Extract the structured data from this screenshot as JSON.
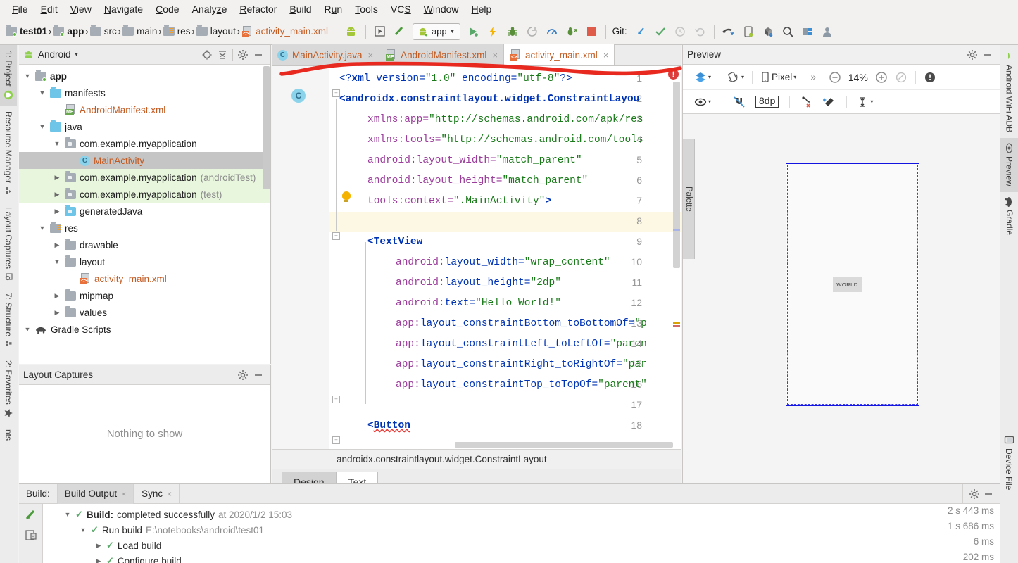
{
  "menu": {
    "items": [
      "File",
      "Edit",
      "View",
      "Navigate",
      "Code",
      "Analyze",
      "Refactor",
      "Build",
      "Run",
      "Tools",
      "VCS",
      "Window",
      "Help"
    ]
  },
  "toolbar": {
    "breadcrumb": [
      {
        "label": "test01",
        "style": "bold",
        "icon": "module-icon"
      },
      {
        "label": "app",
        "style": "bold",
        "icon": "module-icon"
      },
      {
        "label": "src",
        "style": "plain",
        "icon": "folder-icon"
      },
      {
        "label": "main",
        "style": "plain",
        "icon": "folder-icon"
      },
      {
        "label": "res",
        "style": "plain",
        "icon": "res-folder-icon"
      },
      {
        "label": "layout",
        "style": "plain",
        "icon": "folder-icon"
      },
      {
        "label": "activity_main.xml",
        "style": "orange",
        "icon": "xml-file-icon"
      }
    ],
    "separator": "›",
    "run_config": "app",
    "git_label": "Git:",
    "buttons": [
      "avd-manager-icon",
      "run-device-icon",
      "sdk-manager-icon",
      "run-icon",
      "apply-changes-icon",
      "debug-icon",
      "attach-debugger-icon",
      "profiler-icon",
      "run-coverage-icon",
      "stop-icon",
      "git-update-icon",
      "git-commit-icon",
      "git-history-icon",
      "git-revert-icon",
      "sync-gradle-icon",
      "avd-icon",
      "sdk-download-icon",
      "search-everywhere-icon",
      "project-structure-icon",
      "settings-avatar-icon"
    ]
  },
  "left_strip": {
    "tabs": [
      {
        "label": "1: Project",
        "icon": "android-icon",
        "active": true
      },
      {
        "label": "Resource Manager",
        "icon": "resource-icon",
        "active": false
      },
      {
        "label": "Layout Captures",
        "icon": "capture-icon",
        "active": false
      },
      {
        "label": "7: Structure",
        "icon": "structure-icon",
        "active": false
      },
      {
        "label": "2: Favorites",
        "icon": "star-icon",
        "active": false
      },
      {
        "label": "nts",
        "icon": "docs-icon",
        "active": false
      }
    ]
  },
  "right_strip": {
    "tabs": [
      {
        "label": "Android WiFi ADB",
        "icon": "wifi-adb-icon",
        "active": false
      },
      {
        "label": "Preview",
        "icon": "eye-icon",
        "active": true
      },
      {
        "label": "Gradle",
        "icon": "gradle-elephant-icon",
        "active": false
      },
      {
        "label": "Device File",
        "icon": "device-icon",
        "active": false
      }
    ]
  },
  "project_panel": {
    "title": "Android",
    "title_caret": "▾",
    "header_icons": [
      "locate-icon",
      "collapse-all-icon",
      "gear-icon",
      "minimize-icon"
    ],
    "tree": [
      {
        "indent": 0,
        "arrow": "▼",
        "icon": "module-icon",
        "label": "app",
        "style": "bold"
      },
      {
        "indent": 1,
        "arrow": "▼",
        "icon": "folder-blue-icon",
        "label": "manifests",
        "style": "plain"
      },
      {
        "indent": 2,
        "arrow": "",
        "icon": "manifest-file-icon",
        "label": "AndroidManifest.xml",
        "style": "orange"
      },
      {
        "indent": 1,
        "arrow": "▼",
        "icon": "folder-blue-icon",
        "label": "java",
        "style": "plain"
      },
      {
        "indent": 2,
        "arrow": "▼",
        "icon": "package-icon",
        "label": "com.example.myapplication",
        "style": "plain"
      },
      {
        "indent": 3,
        "arrow": "",
        "icon": "class-icon",
        "label": "MainActivity",
        "style": "orange",
        "selected": true
      },
      {
        "indent": 2,
        "arrow": "▶",
        "icon": "package-icon",
        "label": "com.example.myapplication",
        "suffix": "(androidTest)",
        "style": "plain",
        "green": true
      },
      {
        "indent": 2,
        "arrow": "▶",
        "icon": "package-icon",
        "label": "com.example.myapplication",
        "suffix": "(test)",
        "style": "plain",
        "green": true
      },
      {
        "indent": 2,
        "arrow": "▶",
        "icon": "generated-folder-icon",
        "label": "generatedJava",
        "style": "plain"
      },
      {
        "indent": 1,
        "arrow": "▼",
        "icon": "res-folder-icon",
        "label": "res",
        "style": "plain"
      },
      {
        "indent": 2,
        "arrow": "▶",
        "icon": "folder-icon",
        "label": "drawable",
        "style": "plain"
      },
      {
        "indent": 2,
        "arrow": "▼",
        "icon": "folder-icon",
        "label": "layout",
        "style": "plain"
      },
      {
        "indent": 3,
        "arrow": "",
        "icon": "xml-file-icon",
        "label": "activity_main.xml",
        "style": "orange"
      },
      {
        "indent": 2,
        "arrow": "▶",
        "icon": "folder-icon",
        "label": "mipmap",
        "style": "plain"
      },
      {
        "indent": 2,
        "arrow": "▶",
        "icon": "folder-icon",
        "label": "values",
        "style": "plain"
      },
      {
        "indent": 0,
        "arrow": "▼",
        "icon": "gradle-elephant-icon",
        "label": "Gradle Scripts",
        "style": "plain"
      }
    ]
  },
  "layout_captures_panel": {
    "title": "Layout Captures",
    "empty_text": "Nothing to show",
    "header_icons": [
      "gear-icon",
      "minimize-icon"
    ]
  },
  "editor": {
    "tabs": [
      {
        "label": "MainActivity.java",
        "icon": "class-icon",
        "active": false,
        "close": "×"
      },
      {
        "label": "AndroidManifest.xml",
        "icon": "manifest-file-icon",
        "active": false,
        "close": "×"
      },
      {
        "label": "activity_main.xml",
        "icon": "xml-file-icon",
        "active": true,
        "close": "×"
      }
    ],
    "error_badge": "!",
    "breadcrumb": "androidx.constraintlayout.widget.ConstraintLayout",
    "bottom_tabs": [
      {
        "label": "Design",
        "active": false
      },
      {
        "label": "Text",
        "active": true
      }
    ],
    "current_line": 8,
    "lines": [
      {
        "n": 1,
        "segments": [
          {
            "t": "<?",
            "c": "tok-pi"
          },
          {
            "t": "xml",
            "c": "tok-tag"
          },
          {
            "t": " version=",
            "c": "tok-pi"
          },
          {
            "t": "\"1.0\"",
            "c": "tok-str"
          },
          {
            "t": " encoding=",
            "c": "tok-pi"
          },
          {
            "t": "\"utf-8\"",
            "c": "tok-str"
          },
          {
            "t": "?>",
            "c": "tok-pi"
          }
        ],
        "indent": 0
      },
      {
        "n": 2,
        "segments": [
          {
            "t": "<androidx.constraintlayout.widget.ConstraintLayou",
            "c": "tok-tag"
          }
        ],
        "indent": 0
      },
      {
        "n": 3,
        "segments": [
          {
            "t": "xmlns:app=",
            "c": "tok-attr"
          },
          {
            "t": "\"http://schemas.android.com/apk/res",
            "c": "tok-str"
          }
        ],
        "indent": 1
      },
      {
        "n": 4,
        "segments": [
          {
            "t": "xmlns:tools=",
            "c": "tok-attr"
          },
          {
            "t": "\"http://schemas.android.com/tools",
            "c": "tok-str"
          }
        ],
        "indent": 1
      },
      {
        "n": 5,
        "segments": [
          {
            "t": "android:layout_width=",
            "c": "tok-attr"
          },
          {
            "t": "\"match_parent\"",
            "c": "tok-str"
          }
        ],
        "indent": 1
      },
      {
        "n": 6,
        "segments": [
          {
            "t": "android:layout_height=",
            "c": "tok-attr"
          },
          {
            "t": "\"match_parent\"",
            "c": "tok-str"
          }
        ],
        "indent": 1
      },
      {
        "n": 7,
        "segments": [
          {
            "t": "tools:context=",
            "c": "tok-attr"
          },
          {
            "t": "\".MainActivity\"",
            "c": "tok-str"
          },
          {
            "t": ">",
            "c": "tok-tag"
          }
        ],
        "indent": 1
      },
      {
        "n": 8,
        "segments": [],
        "indent": 0
      },
      {
        "n": 9,
        "segments": [
          {
            "t": "<TextView",
            "c": "tok-tag"
          }
        ],
        "indent": 1
      },
      {
        "n": 10,
        "segments": [
          {
            "t": "android:",
            "c": "tok-attr"
          },
          {
            "t": "layout_width=",
            "c": "tok-attr2"
          },
          {
            "t": "\"wrap_content\"",
            "c": "tok-str"
          }
        ],
        "indent": 2
      },
      {
        "n": 11,
        "segments": [
          {
            "t": "android:",
            "c": "tok-attr"
          },
          {
            "t": "layout_height=",
            "c": "tok-attr2"
          },
          {
            "t": "\"2dp\"",
            "c": "tok-str"
          }
        ],
        "indent": 2
      },
      {
        "n": 12,
        "segments": [
          {
            "t": "android:",
            "c": "tok-attr"
          },
          {
            "t": "text=",
            "c": "tok-attr2"
          },
          {
            "t": "\"Hello World!\"",
            "c": "tok-str"
          }
        ],
        "indent": 2
      },
      {
        "n": 13,
        "segments": [
          {
            "t": "app:",
            "c": "tok-attr"
          },
          {
            "t": "layout_constraintBottom_toBottomOf=",
            "c": "tok-attr2"
          },
          {
            "t": "\"p",
            "c": "tok-str"
          }
        ],
        "indent": 2
      },
      {
        "n": 14,
        "segments": [
          {
            "t": "app:",
            "c": "tok-attr"
          },
          {
            "t": "layout_constraintLeft_toLeftOf=",
            "c": "tok-attr2"
          },
          {
            "t": "\"paren",
            "c": "tok-str"
          }
        ],
        "indent": 2
      },
      {
        "n": 15,
        "segments": [
          {
            "t": "app:",
            "c": "tok-attr"
          },
          {
            "t": "layout_constraintRight_toRightOf=",
            "c": "tok-attr2"
          },
          {
            "t": "\"par",
            "c": "tok-str"
          }
        ],
        "indent": 2
      },
      {
        "n": 16,
        "segments": [
          {
            "t": "app:",
            "c": "tok-attr"
          },
          {
            "t": "layout_constraintTop_toTopOf=",
            "c": "tok-attr2"
          },
          {
            "t": "\"parent\"",
            "c": "tok-str"
          }
        ],
        "indent": 2
      },
      {
        "n": 17,
        "segments": [],
        "indent": 0
      },
      {
        "n": 18,
        "segments": [
          {
            "t": "<",
            "c": "tok-tag"
          },
          {
            "t": "Button",
            "c": "tok-tag err-underline"
          }
        ],
        "indent": 1
      }
    ]
  },
  "preview_panel": {
    "title": "Preview",
    "header_icons": [
      "gear-icon",
      "minimize-icon"
    ],
    "palette_label": "Palette",
    "toolbar_row1": [
      {
        "name": "design-mode-icon",
        "label": "",
        "caret": "▾"
      },
      {
        "name": "orientation-icon",
        "label": "",
        "caret": "▾"
      },
      {
        "name": "device-icon",
        "label": "Pixel",
        "caret": "▾"
      },
      {
        "name": "overflow-icon",
        "label": "»",
        "caret": ""
      },
      {
        "name": "zoom-out-icon",
        "label": "",
        "caret": ""
      },
      {
        "name": "zoom-level",
        "label": "14%",
        "caret": ""
      },
      {
        "name": "zoom-in-icon",
        "label": "",
        "caret": ""
      },
      {
        "name": "zoom-fit-icon",
        "label": "",
        "caret": ""
      },
      {
        "name": "issues-icon",
        "label": "",
        "caret": ""
      }
    ],
    "toolbar_row2": [
      {
        "name": "visibility-icon",
        "label": "",
        "caret": "▾"
      },
      {
        "name": "autoconnect-off-icon",
        "label": "",
        "caret": ""
      },
      {
        "name": "default-margin-icon",
        "label": "8dp",
        "caret": ""
      },
      {
        "name": "clear-constraints-icon",
        "label": "",
        "caret": ""
      },
      {
        "name": "infer-constraints-icon",
        "label": "",
        "caret": ""
      },
      {
        "name": "guidelines-icon",
        "label": "",
        "caret": "▾"
      }
    ],
    "device_widget_label": "WORLD"
  },
  "build_panel": {
    "label": "Build:",
    "tabs": [
      {
        "label": "Build Output",
        "active": true,
        "close": "×"
      },
      {
        "label": "Sync",
        "active": false,
        "close": "×"
      }
    ],
    "header_icons": [
      "gear-icon",
      "minimize-icon"
    ],
    "side_icons": [
      "rerun-build-icon",
      "toggle-view-icon"
    ],
    "rows": [
      {
        "indent": 0,
        "arrow": "▼",
        "check": "✓",
        "bold": "Build:",
        "text": "completed successfully",
        "grey": "at 2020/1/2 15:03",
        "time": "2 s 443 ms"
      },
      {
        "indent": 1,
        "arrow": "▼",
        "check": "✓",
        "bold": "",
        "text": "Run build",
        "grey": "E:\\notebooks\\android\\test01",
        "time": "1 s 686 ms"
      },
      {
        "indent": 2,
        "arrow": "▶",
        "check": "✓",
        "bold": "",
        "text": "Load build",
        "grey": "",
        "time": "6 ms"
      },
      {
        "indent": 2,
        "arrow": "▶",
        "check": "✓",
        "bold": "",
        "text": "Configure build",
        "grey": "",
        "time": "202 ms"
      }
    ]
  },
  "colors": {
    "accent_orange": "#c25a21",
    "success_green": "#59a869",
    "error_red": "#dc3c3c",
    "annotation_red": "#e8291f",
    "device_border_blue": "#1414e0",
    "selection_grey": "#c5c5c5",
    "test_source_green": "#e8f6dd"
  }
}
